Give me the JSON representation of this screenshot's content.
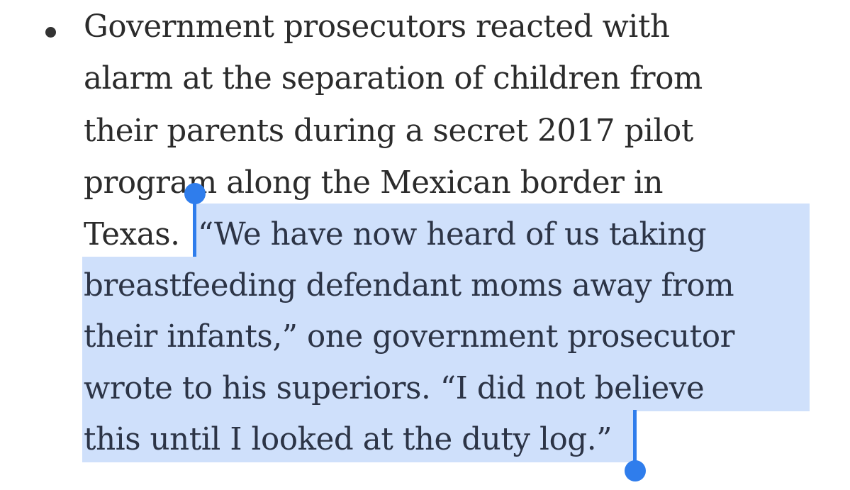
{
  "article": {
    "bullet_item": {
      "lines": [
        "Government prosecutors reacted with",
        "alarm at the separation of children from",
        "their parents during a secret 2017 pilot",
        "program along the Mexican border in",
        "Texas.",
        "“We have now heard of us taking",
        "breastfeeding defendant moms away from",
        "their infants,” one government prosecutor",
        "wrote to his superiors. “I did not believe",
        "this until I looked at the duty log.”"
      ]
    }
  },
  "selection": {
    "color": "#cfe0fb",
    "handle_color": "#2f7dec"
  }
}
